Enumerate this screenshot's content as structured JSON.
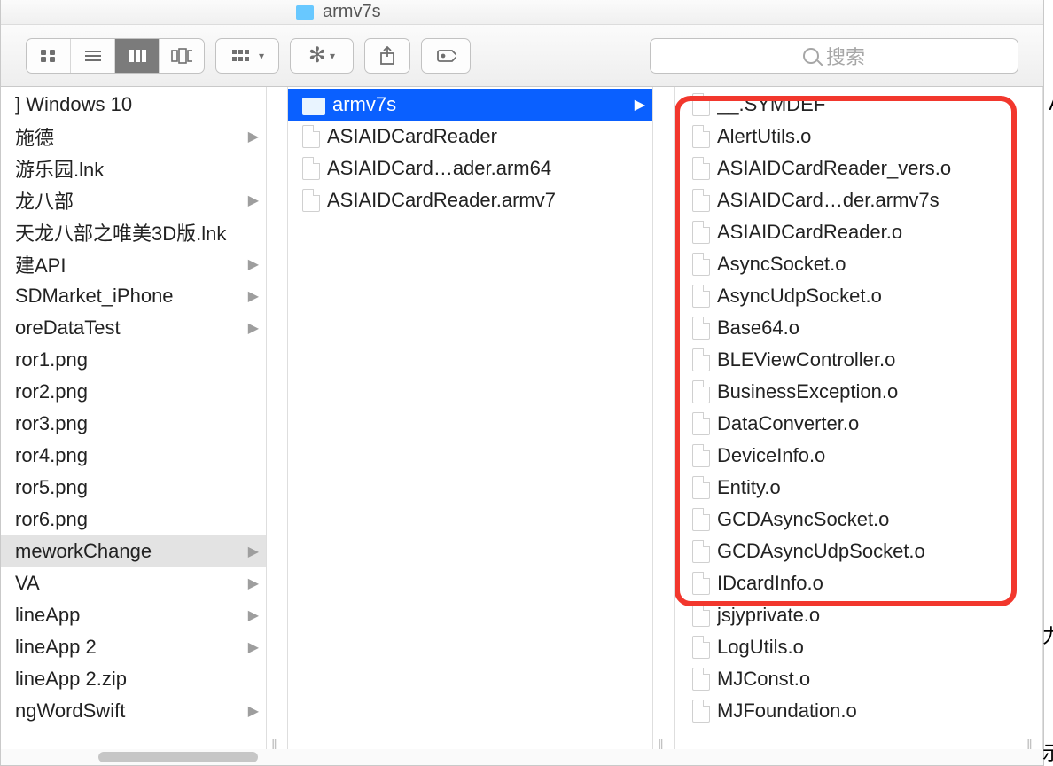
{
  "title": "armv7s",
  "search_placeholder": "搜索",
  "col_divider_handle": "||",
  "col1": [
    {
      "label": "] Windows 10",
      "folder": true,
      "expand": false
    },
    {
      "label": "施德",
      "folder": true,
      "expand": true
    },
    {
      "label": "游乐园.lnk",
      "folder": false,
      "expand": false
    },
    {
      "label": "龙八部",
      "folder": true,
      "expand": true
    },
    {
      "label": "天龙八部之唯美3D版.lnk",
      "folder": false,
      "expand": false
    },
    {
      "label": "建API",
      "folder": true,
      "expand": true
    },
    {
      "label": "SDMarket_iPhone",
      "folder": true,
      "expand": true
    },
    {
      "label": "oreDataTest",
      "folder": true,
      "expand": true
    },
    {
      "label": "ror1.png",
      "folder": false,
      "expand": false
    },
    {
      "label": "ror2.png",
      "folder": false,
      "expand": false
    },
    {
      "label": "ror3.png",
      "folder": false,
      "expand": false
    },
    {
      "label": "ror4.png",
      "folder": false,
      "expand": false
    },
    {
      "label": "ror5.png",
      "folder": false,
      "expand": false
    },
    {
      "label": "ror6.png",
      "folder": false,
      "expand": false
    },
    {
      "label": "meworkChange",
      "folder": true,
      "expand": true,
      "subsel": true
    },
    {
      "label": "VA",
      "folder": true,
      "expand": true
    },
    {
      "label": "lineApp",
      "folder": true,
      "expand": true
    },
    {
      "label": "lineApp 2",
      "folder": true,
      "expand": true
    },
    {
      "label": "lineApp 2.zip",
      "folder": false,
      "expand": false
    },
    {
      "label": "ngWordSwift",
      "folder": true,
      "expand": true
    }
  ],
  "col2": [
    {
      "label": "armv7s",
      "folder": true,
      "expand": true,
      "selected": true
    },
    {
      "label": "ASIAIDCardReader",
      "folder": false,
      "expand": false
    },
    {
      "label": "ASIAIDCard…ader.arm64",
      "folder": false,
      "expand": false
    },
    {
      "label": "ASIAIDCardReader.armv7",
      "folder": false,
      "expand": false
    }
  ],
  "col3": [
    {
      "label": "__.SYMDEF"
    },
    {
      "label": "AlertUtils.o"
    },
    {
      "label": "ASIAIDCardReader_vers.o"
    },
    {
      "label": "ASIAIDCard…der.armv7s"
    },
    {
      "label": "ASIAIDCardReader.o"
    },
    {
      "label": "AsyncSocket.o"
    },
    {
      "label": "AsyncUdpSocket.o"
    },
    {
      "label": "Base64.o"
    },
    {
      "label": "BLEViewController.o"
    },
    {
      "label": "BusinessException.o"
    },
    {
      "label": "DataConverter.o"
    },
    {
      "label": "DeviceInfo.o"
    },
    {
      "label": "Entity.o"
    },
    {
      "label": "GCDAsyncSocket.o"
    },
    {
      "label": "GCDAsyncUdpSocket.o"
    },
    {
      "label": "IDcardInfo.o"
    },
    {
      "label": "jsjyprivate.o"
    },
    {
      "label": "LogUtils.o"
    },
    {
      "label": "MJConst.o"
    },
    {
      "label": "MJFoundation.o"
    }
  ],
  "right_edge_chars": [
    "A",
    "力",
    "示"
  ]
}
